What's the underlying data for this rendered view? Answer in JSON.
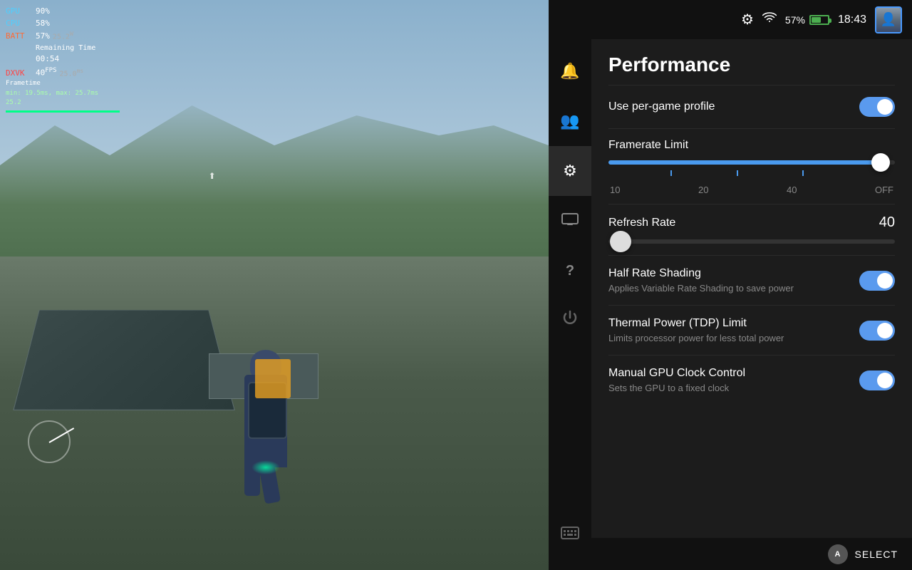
{
  "game": {
    "hud": {
      "gpu_label": "GPU",
      "gpu_val": "90%",
      "cpu_label": "CPU",
      "cpu_val": "58%",
      "batt_label": "BATT",
      "batt_val": "57%",
      "batt_watts": "25.2",
      "batt_watts_unit": "W",
      "remaining_label": "Remaining Time",
      "time_val": "00:54",
      "dxvk_label": "DXVK",
      "fps_val": "40",
      "fps_unit": "FPS",
      "ms_val": "25.0",
      "ms_unit": "ms",
      "frametime_label": "Frametime",
      "frametime_detail": "min: 19.5ms, max: 25.7ms",
      "frametime_val": "25.2"
    }
  },
  "status_bar": {
    "battery_pct": "57%",
    "time": "18:43",
    "wifi_icon": "wifi-icon",
    "settings_icon": "settings-icon",
    "avatar_icon": "avatar-icon"
  },
  "sidebar": {
    "items": [
      {
        "id": "notifications",
        "icon": "🔔",
        "label": "Notifications",
        "active": false
      },
      {
        "id": "users",
        "icon": "👥",
        "label": "Users",
        "active": false
      },
      {
        "id": "settings",
        "icon": "⚙",
        "label": "Settings",
        "active": true
      },
      {
        "id": "display",
        "icon": "▭",
        "label": "Display",
        "active": false
      },
      {
        "id": "help",
        "icon": "?",
        "label": "Help",
        "active": false
      },
      {
        "id": "power",
        "icon": "⚡",
        "label": "Power",
        "active": false
      },
      {
        "id": "keyboard",
        "icon": "⌨",
        "label": "Keyboard",
        "active": false
      }
    ]
  },
  "panel": {
    "title": "Performance",
    "settings": [
      {
        "id": "per-game-profile",
        "label": "Use per-game profile",
        "type": "toggle",
        "value": true
      },
      {
        "id": "framerate-limit",
        "label": "Framerate Limit",
        "type": "slider",
        "slider_fill_pct": 95,
        "thumb_pct": 95,
        "labels": [
          "10",
          "20",
          "40",
          "OFF"
        ]
      },
      {
        "id": "refresh-rate",
        "label": "Refresh Rate",
        "value": "40",
        "type": "slider-simple",
        "thumb_pct": 2
      },
      {
        "id": "half-rate-shading",
        "label": "Half Rate Shading",
        "sublabel": "Applies Variable Rate Shading to save power",
        "type": "toggle",
        "value": true
      },
      {
        "id": "tdp-limit",
        "label": "Thermal Power (TDP) Limit",
        "sublabel": "Limits processor power for less total power",
        "type": "toggle",
        "value": true
      },
      {
        "id": "manual-gpu-clock",
        "label": "Manual GPU Clock Control",
        "sublabel": "Sets the GPU to a fixed clock",
        "type": "toggle",
        "value": true
      }
    ]
  },
  "bottom_bar": {
    "button_label": "A",
    "action_label": "SELECT"
  }
}
